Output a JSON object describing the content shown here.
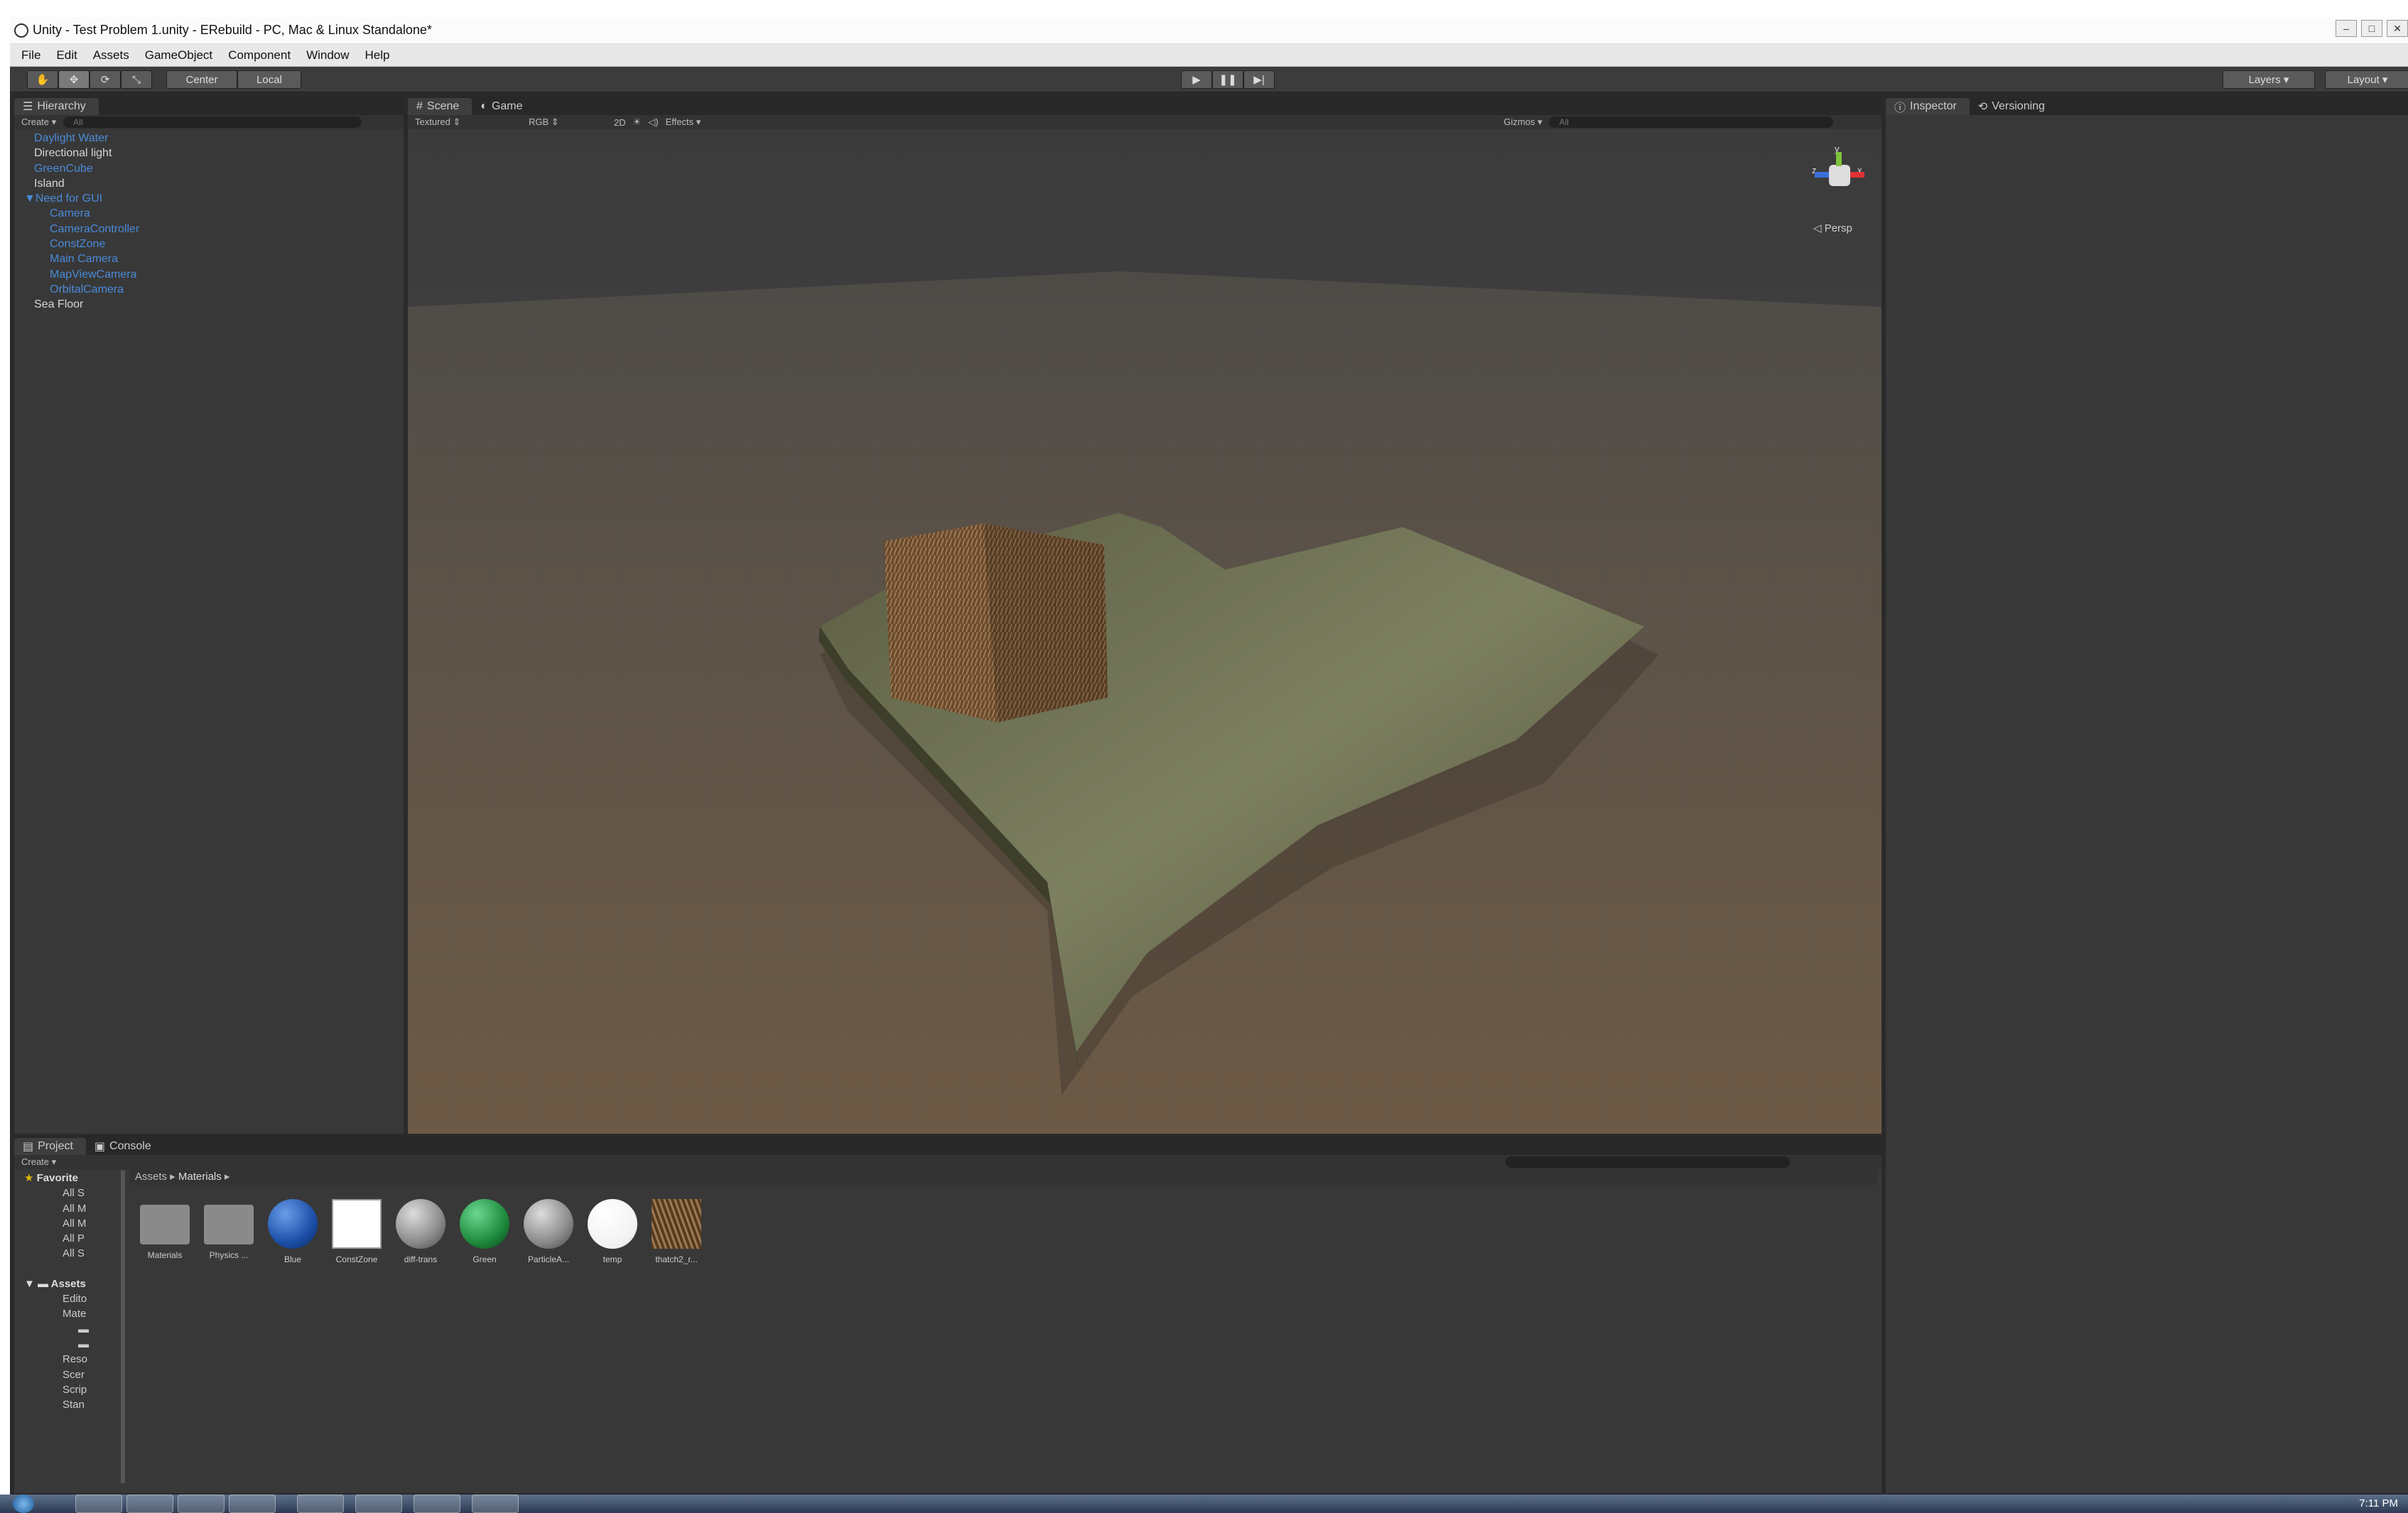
{
  "window": {
    "title": "Unity - Test Problem 1.unity - ERebuild - PC, Mac & Linux Standalone*"
  },
  "menu": [
    "File",
    "Edit",
    "Assets",
    "GameObject",
    "Component",
    "Window",
    "Help"
  ],
  "toolbar": {
    "center": "Center",
    "local": "Local",
    "layers": "Layers",
    "layout": "Layout"
  },
  "hierarchy": {
    "tab": "Hierarchy",
    "create": "Create",
    "search_placeholder": "All",
    "items": [
      {
        "label": "Daylight Water",
        "color": "blue",
        "indent": 0
      },
      {
        "label": "Directional light",
        "color": "white",
        "indent": 0
      },
      {
        "label": "GreenCube",
        "color": "blue",
        "indent": 0
      },
      {
        "label": "Island",
        "color": "white",
        "indent": 0
      },
      {
        "label": "Need for GUI",
        "color": "blue",
        "indent": 0,
        "expanded": true
      },
      {
        "label": "Camera",
        "color": "blue",
        "indent": 1
      },
      {
        "label": "CameraController",
        "color": "blue",
        "indent": 1
      },
      {
        "label": "ConstZone",
        "color": "blue",
        "indent": 1
      },
      {
        "label": "Main Camera",
        "color": "blue",
        "indent": 1
      },
      {
        "label": "MapViewCamera",
        "color": "blue",
        "indent": 1
      },
      {
        "label": "OrbitalCamera",
        "color": "blue",
        "indent": 1
      },
      {
        "label": "Sea Floor",
        "color": "white",
        "indent": 0
      }
    ]
  },
  "scene": {
    "tabs": [
      "Scene",
      "Game"
    ],
    "shading": "Textured",
    "render": "RGB",
    "mode2d": "2D",
    "effects": "Effects",
    "gizmos": "Gizmos",
    "gizmo_search": "All",
    "persp": "Persp",
    "axis": {
      "x": "x",
      "y": "y",
      "z": "z"
    }
  },
  "inspector": {
    "tabs": [
      "Inspector",
      "Versioning"
    ]
  },
  "project": {
    "tabs": [
      "Project",
      "Console"
    ],
    "create": "Create",
    "favorites_label": "Favorite",
    "favorites": [
      "All S",
      "All M",
      "All M",
      "All P",
      "All S"
    ],
    "assets_label": "Assets",
    "folders": [
      "Edito",
      "Mate",
      "",
      "",
      "Reso",
      "Scer",
      "Scrip",
      "Stan",
      "",
      "",
      "",
      ""
    ],
    "breadcrumb": [
      "Assets",
      "Materials"
    ],
    "assets": [
      {
        "label": "Materials",
        "kind": "folder"
      },
      {
        "label": "Physics ...",
        "kind": "folder"
      },
      {
        "label": "Blue",
        "kind": "sphere",
        "color": "#1c4fa8"
      },
      {
        "label": "ConstZone",
        "kind": "white-square"
      },
      {
        "label": "diff-trans",
        "kind": "sphere",
        "color": "#8a8a8a"
      },
      {
        "label": "Green",
        "kind": "sphere",
        "color": "#1e8a3c"
      },
      {
        "label": "ParticleA...",
        "kind": "sphere",
        "color": "#8a8a8a"
      },
      {
        "label": "temp",
        "kind": "sphere",
        "color": "#ffffff"
      },
      {
        "label": "thatch2_r...",
        "kind": "texture"
      }
    ]
  },
  "clock": "7:11 PM"
}
